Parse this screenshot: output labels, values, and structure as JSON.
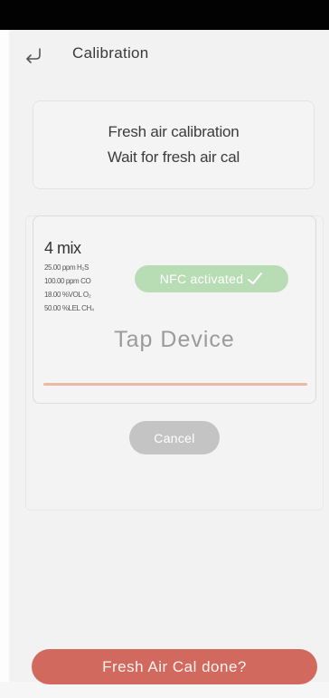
{
  "header": {
    "title": "Calibration",
    "back_icon": "return-arrow-icon"
  },
  "info": {
    "line1": "Fresh air calibration",
    "line2": "Wait for fresh air cal"
  },
  "gas_card": {
    "name": "4 mix",
    "lines": [
      "25.00 ppm H₂S",
      "100.00 ppm CO",
      "18.00 %VOL O₂",
      "50.00 %LEL CH₄"
    ],
    "nfc_label": "NFC activated",
    "nfc_icon": "check-icon",
    "tap_label": "Tap Device"
  },
  "buttons": {
    "cancel": "Cancel",
    "done": "Fresh Air Cal done?"
  },
  "colors": {
    "status_bar": "#020202",
    "nfc_pill": "#b8ddb5",
    "progress": "#ebb9a4",
    "cancel": "#c4c4c4",
    "done": "#d2695e"
  }
}
